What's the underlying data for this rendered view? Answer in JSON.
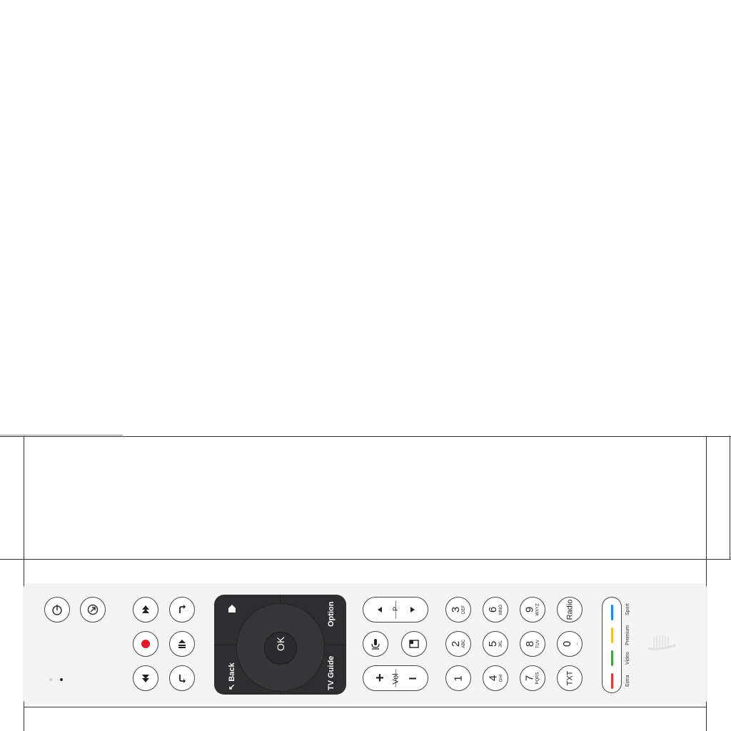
{
  "remote": {
    "power_icon": "power-icon",
    "settings_icon": "settings-icon",
    "nav": {
      "home_icon": "home-icon",
      "ok_label": "OK",
      "option_label": "Option",
      "back_label": "↖ Back",
      "tv_guide_label": "TV Guide"
    },
    "program_label": "P",
    "vol_label": "Vol",
    "vol_plus": "+",
    "vol_minus": "–",
    "keys": {
      "k1": {
        "n": "1",
        "l": ""
      },
      "k2": {
        "n": "2",
        "l": "ABC"
      },
      "k3": {
        "n": "3",
        "l": "DEF"
      },
      "k4": {
        "n": "4",
        "l": "GHI"
      },
      "k5": {
        "n": "5",
        "l": "JKL"
      },
      "k6": {
        "n": "6",
        "l": "MNO"
      },
      "k7": {
        "n": "7",
        "l": "PQRS"
      },
      "k8": {
        "n": "8",
        "l": "TUV"
      },
      "k9": {
        "n": "9",
        "l": "WXYZ"
      },
      "k0": {
        "n": "0",
        "l": "_"
      }
    },
    "radio_label": "Radio",
    "txt_label": "TXT",
    "color_labels": {
      "sport": "Sport",
      "premium": "Premium",
      "video": "Video",
      "extra": "Extra"
    },
    "colors": {
      "blue": "#1e88e5",
      "yellow": "#f2c12e",
      "green": "#43a047",
      "red": "#e53935",
      "record": "#e5172b"
    }
  }
}
